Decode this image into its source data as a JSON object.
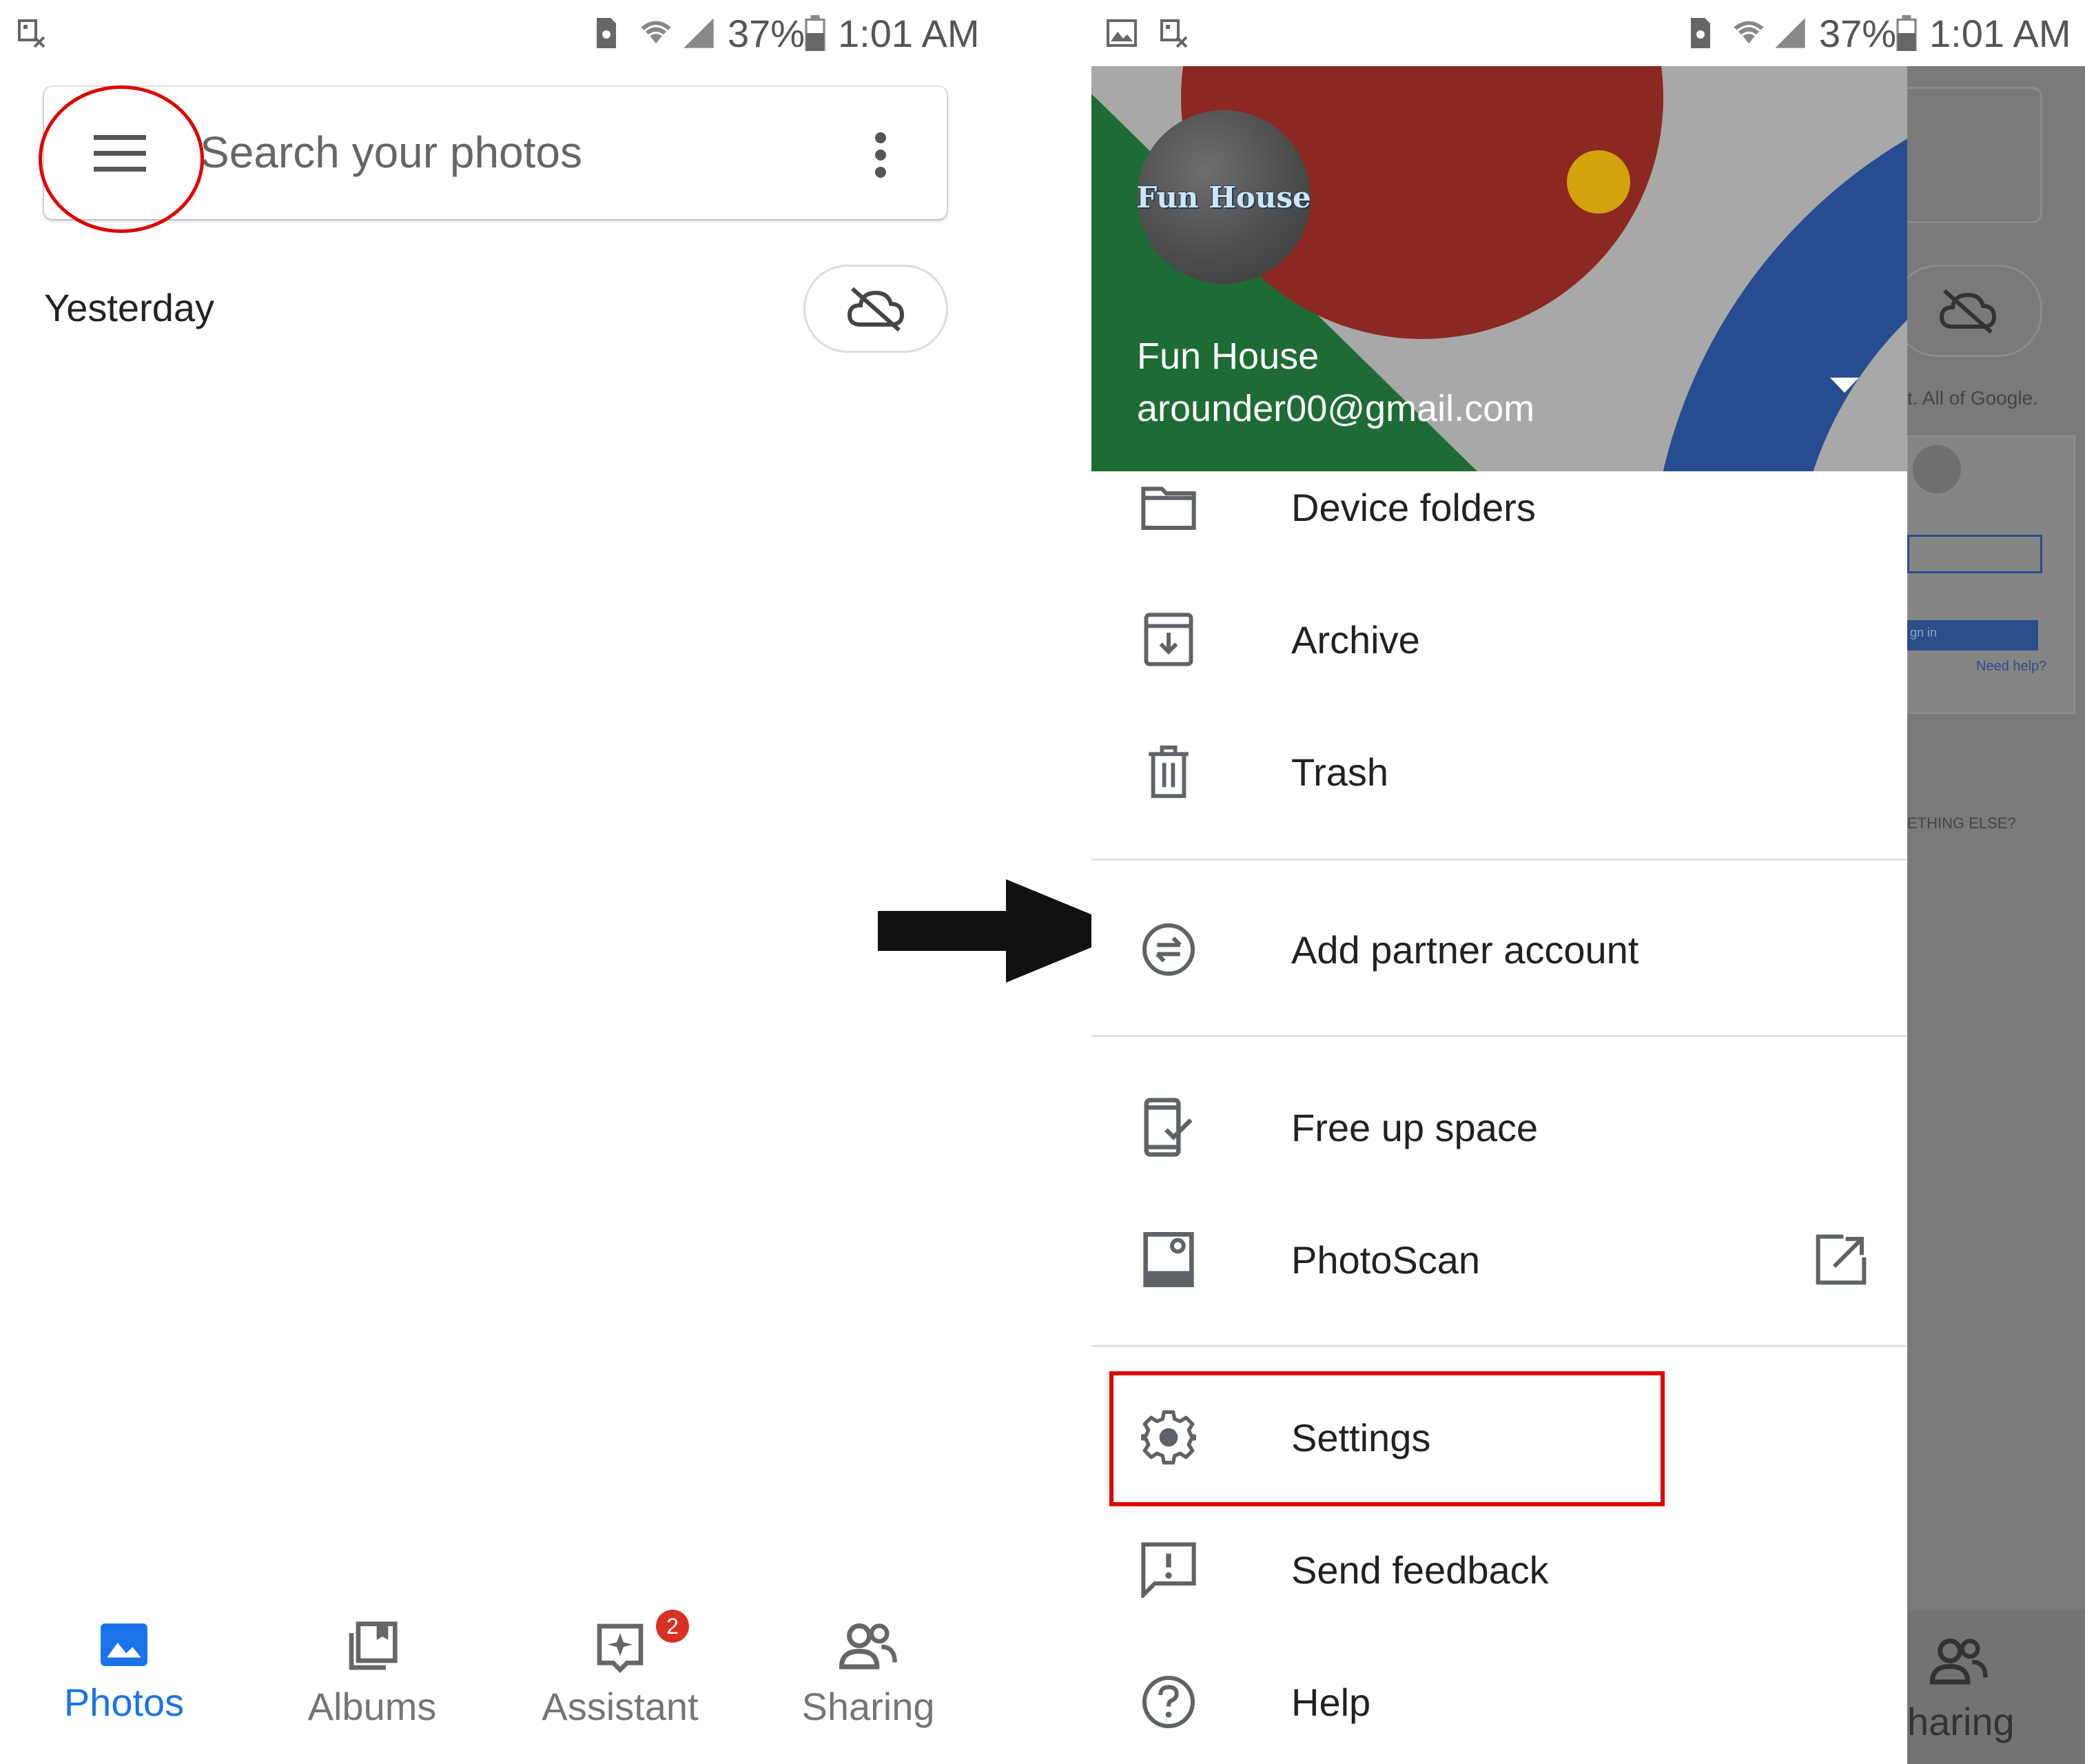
{
  "left_screen": {
    "status": {
      "battery": "37%",
      "time": "1:01 AM"
    },
    "search": {
      "placeholder": "Search your photos"
    },
    "section_header": "Yesterday",
    "bottom_nav": [
      {
        "label": "Photos",
        "icon": "photos-icon",
        "active": true
      },
      {
        "label": "Albums",
        "icon": "albums-icon"
      },
      {
        "label": "Assistant",
        "icon": "assistant-icon",
        "badge": "2"
      },
      {
        "label": "Sharing",
        "icon": "sharing-icon"
      }
    ]
  },
  "right_screen": {
    "status": {
      "battery": "37%",
      "time": "1:01 AM"
    },
    "account": {
      "avatar_text": "Fun House",
      "name": "Fun House",
      "email": "arounder00@gmail.com"
    },
    "menu": [
      {
        "label": "Device folders",
        "icon": "folder-icon"
      },
      {
        "label": "Archive",
        "icon": "archive-icon"
      },
      {
        "label": "Trash",
        "icon": "trash-icon"
      },
      {
        "label": "Add partner account",
        "icon": "partner-icon"
      },
      {
        "label": "Free up space",
        "icon": "free-up-space-icon"
      },
      {
        "label": "PhotoScan",
        "icon": "photoscan-icon",
        "trailing_icon": "open-external-icon"
      },
      {
        "label": "Settings",
        "icon": "gear-icon"
      },
      {
        "label": "Send feedback",
        "icon": "feedback-icon"
      },
      {
        "label": "Help",
        "icon": "help-icon"
      }
    ],
    "background_fragments": {
      "text1": "t. All of Google.",
      "text2": "gn in",
      "text3": "Need help?",
      "text4": "ETHING ELSE?",
      "nav_label": "haring"
    }
  },
  "colors": {
    "accent_blue": "#1a73e8",
    "annotation_red": "#e00000",
    "badge_red": "#d93025",
    "header_green": "#1e6b35",
    "header_red": "#8b2821",
    "header_blue": "#274d91",
    "header_yellow": "#d4a20b"
  }
}
